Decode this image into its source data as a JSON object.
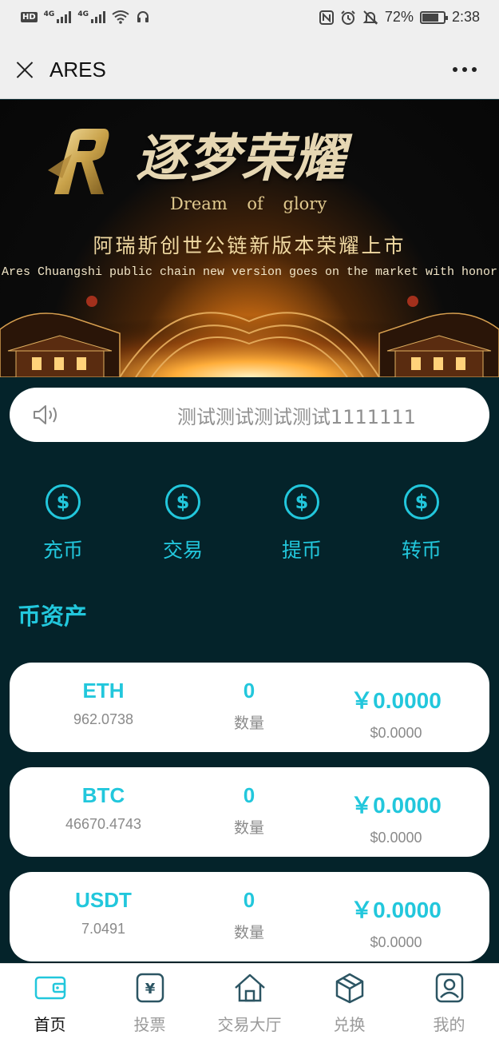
{
  "status_bar": {
    "left_badge": "HD",
    "network1": "4G",
    "network2": "4G",
    "battery": "72%",
    "time": "2:38"
  },
  "header": {
    "title": "ARES",
    "close_icon": "close-icon",
    "more_icon": "more-icon"
  },
  "banner": {
    "logo": "R",
    "title": "逐梦荣耀",
    "subtitle": "Dream of glory",
    "headline_cn": "阿瑞斯创世公链新版本荣耀上市",
    "headline_en": "Ares Chuangshi public chain new version goes on the market with honor",
    "slide_count": 5,
    "active_slide": 1
  },
  "notice": {
    "icon": "speaker-icon",
    "text": "测试测试测试测试1111111"
  },
  "actions": [
    {
      "label": "充币",
      "icon": "dollar-coin-icon"
    },
    {
      "label": "交易",
      "icon": "dollar-coin-icon"
    },
    {
      "label": "提币",
      "icon": "dollar-coin-icon"
    },
    {
      "label": "转币",
      "icon": "dollar-coin-icon"
    }
  ],
  "section_title": "币资产",
  "assets": [
    {
      "name": "ETH",
      "price": "962.0738",
      "quantity": "0",
      "quantity_label": "数量",
      "value_cny": "￥0.0000",
      "value_usd": "$0.0000"
    },
    {
      "name": "BTC",
      "price": "46670.4743",
      "quantity": "0",
      "quantity_label": "数量",
      "value_cny": "￥0.0000",
      "value_usd": "$0.0000"
    },
    {
      "name": "USDT",
      "price": "7.0491",
      "quantity": "0",
      "quantity_label": "数量",
      "value_cny": "￥0.0000",
      "value_usd": "$0.0000"
    }
  ],
  "tabs": [
    {
      "label": "首页",
      "icon": "wallet-icon",
      "active": true
    },
    {
      "label": "投票",
      "icon": "ticket-icon",
      "active": false
    },
    {
      "label": "交易大厅",
      "icon": "house-icon",
      "active": false
    },
    {
      "label": "兑换",
      "icon": "exchange-cube-icon",
      "active": false
    },
    {
      "label": "我的",
      "icon": "user-icon",
      "active": false
    }
  ],
  "colors": {
    "accent": "#22c7dc",
    "background": "#04232a",
    "banner_gold": "#e0c98e"
  }
}
